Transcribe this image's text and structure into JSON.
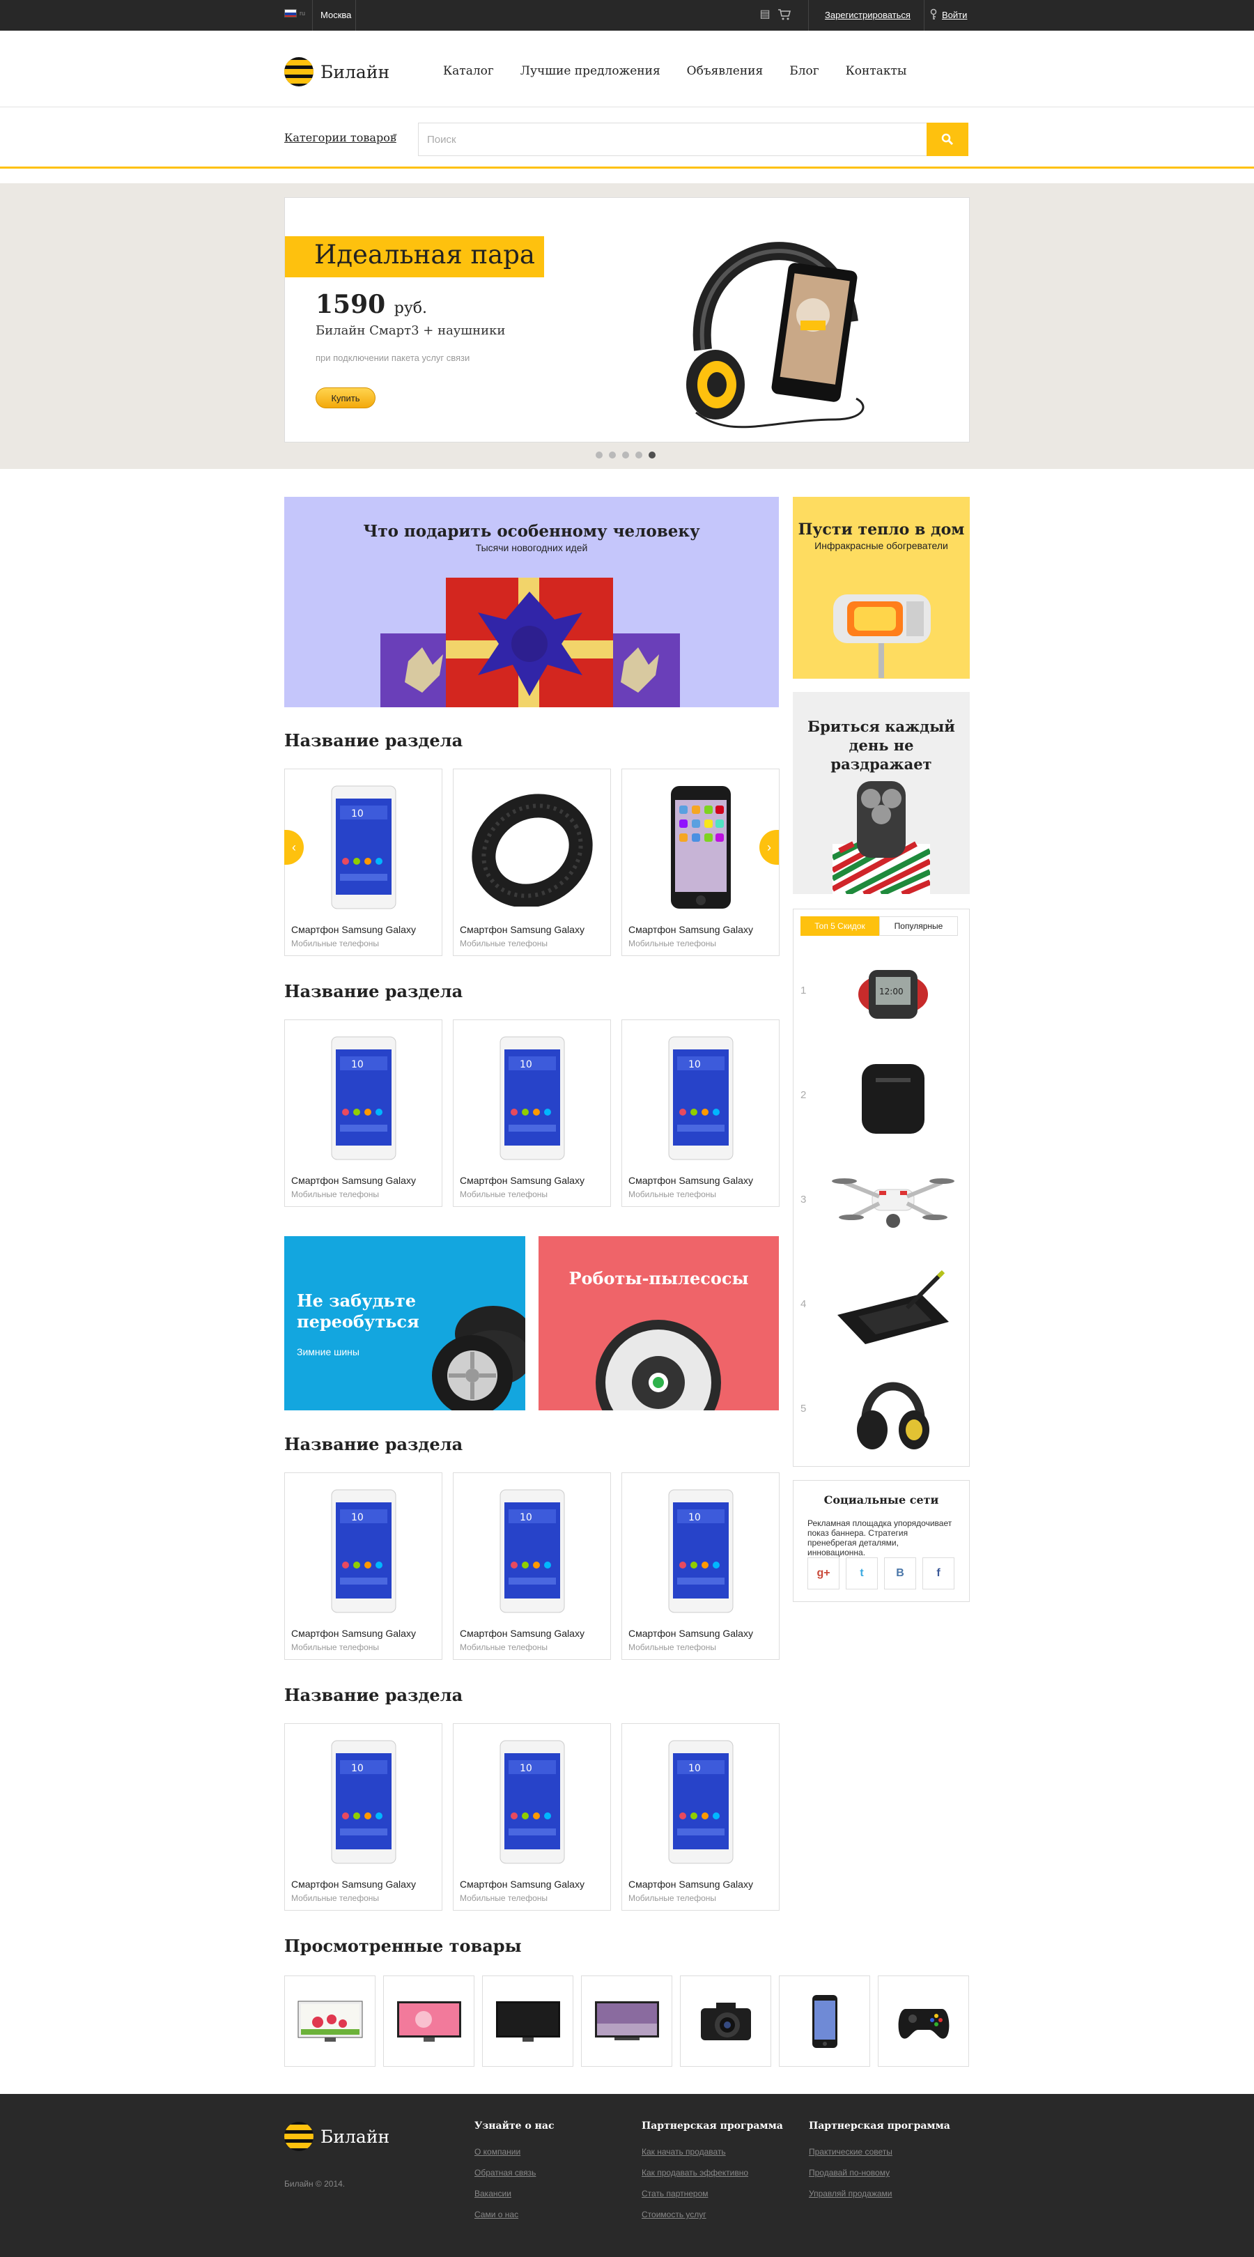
{
  "topbar": {
    "lang": "ru",
    "city": "Москва",
    "register": "Зарегистрироваться",
    "login": "Войти"
  },
  "header": {
    "logo_text": "Билайн",
    "nav": [
      "Каталог",
      "Лучшие предложения",
      "Объявления",
      "Блог",
      "Контакты"
    ]
  },
  "search": {
    "categories_label": "Категории товаров",
    "placeholder": "Поиск"
  },
  "hero": {
    "title": "Идеальная пара",
    "price": "1590",
    "currency": "руб.",
    "subtitle": "Билайн Смарт3 + наушники",
    "note": "при подключении пакета услуг связи",
    "buy_label": "Купить",
    "slides": 5,
    "active_slide": 5
  },
  "promos": {
    "gift": {
      "title": "Что подарить особенному человеку",
      "subtitle": "Тысячи новогодних идей"
    },
    "heat": {
      "title": "Пусти тепло в дом",
      "subtitle": "Инфракрасные обогреватели"
    },
    "shave": {
      "title": "Бриться каждый день не раздражает"
    },
    "tires": {
      "title": "Не забудьте переобуться",
      "subtitle": "Зимние шины"
    },
    "robots": {
      "title": "Роботы-пылесосы"
    }
  },
  "sections": [
    {
      "title": "Название раздела",
      "products": [
        {
          "name": "Смартфон Samsung Galaxy",
          "category": "Мобильные телефоны",
          "icon": "phone-white"
        },
        {
          "name": "Смартфон Samsung Galaxy",
          "category": "Мобильные телефоны",
          "icon": "fitness-band"
        },
        {
          "name": "Смартфон Samsung Galaxy",
          "category": "Мобильные телефоны",
          "icon": "phone-black"
        }
      ]
    },
    {
      "title": "Название раздела",
      "products": [
        {
          "name": "Смартфон Samsung Galaxy",
          "category": "Мобильные телефоны",
          "icon": "phone-white"
        },
        {
          "name": "Смартфон Samsung Galaxy",
          "category": "Мобильные телефоны",
          "icon": "phone-white"
        },
        {
          "name": "Смартфон Samsung Galaxy",
          "category": "Мобильные телефоны",
          "icon": "phone-white"
        }
      ]
    },
    {
      "title": "Название раздела",
      "products": [
        {
          "name": "Смартфон Samsung Galaxy",
          "category": "Мобильные телефоны",
          "icon": "phone-white"
        },
        {
          "name": "Смартфон Samsung Galaxy",
          "category": "Мобильные телефоны",
          "icon": "phone-white"
        },
        {
          "name": "Смартфон Samsung Galaxy",
          "category": "Мобильные телефоны",
          "icon": "phone-white"
        }
      ]
    },
    {
      "title": "Название раздела",
      "products": [
        {
          "name": "Смартфон Samsung Galaxy",
          "category": "Мобильные телефоны",
          "icon": "phone-white"
        },
        {
          "name": "Смартфон Samsung Galaxy",
          "category": "Мобильные телефоны",
          "icon": "phone-white"
        },
        {
          "name": "Смартфон Samsung Galaxy",
          "category": "Мобильные телефоны",
          "icon": "phone-white"
        }
      ]
    }
  ],
  "top": {
    "tabs": [
      "Топ 5 Скидок",
      "Популярные"
    ],
    "items": [
      {
        "rank": "1",
        "icon": "smartwatch"
      },
      {
        "rank": "2",
        "icon": "speaker"
      },
      {
        "rank": "3",
        "icon": "drone"
      },
      {
        "rank": "4",
        "icon": "graphics-tablet"
      },
      {
        "rank": "5",
        "icon": "headphones"
      }
    ]
  },
  "social": {
    "title": "Социальные сети",
    "text": "Рекламная площадка упорядочивает показ баннера. Стратегия пренебрегая деталями, инновационна.",
    "buttons": [
      "g+",
      "t",
      "B",
      "f"
    ]
  },
  "viewed": {
    "title": "Просмотренные товары",
    "items": [
      "tv-flowers",
      "tv-pink",
      "tv-black",
      "tv-purple",
      "camera",
      "iphone",
      "gamepad"
    ]
  },
  "footer": {
    "logo_text": "Билайн",
    "copyright": "Билайн © 2014.",
    "columns": [
      {
        "title": "Узнайте о нас",
        "links": [
          "О компании",
          "Обратная связь",
          "Вакансии",
          "Сами о нас"
        ]
      },
      {
        "title": "Партнерская программа",
        "links": [
          "Как начать продавать",
          "Как продавать эффективно",
          "Стать партнером",
          "Стоимость услуг"
        ]
      },
      {
        "title": "Партнерская программа",
        "links": [
          "Практические советы",
          "Продавай по-новому",
          "Управляй продажами"
        ]
      }
    ]
  },
  "colors": {
    "accent": "#fec10e",
    "dark": "#282828",
    "gift_bg": "#c5c6fb",
    "heat_bg": "#fedc60",
    "tires_bg": "#13a6df",
    "robots_bg": "#ef6469"
  }
}
